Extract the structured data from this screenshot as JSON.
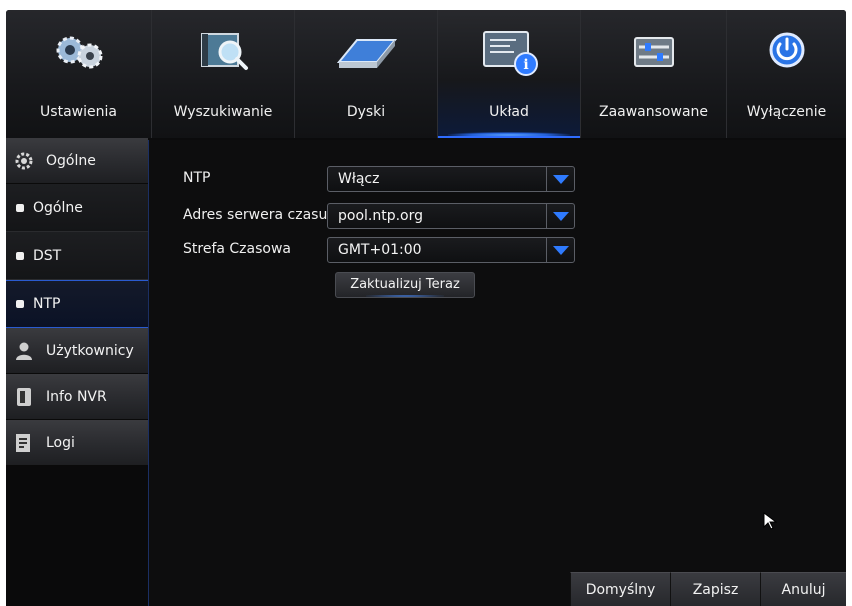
{
  "tabs": [
    {
      "label": "Ustawienia",
      "icon": "gears-icon"
    },
    {
      "label": "Wyszukiwanie",
      "icon": "search-video-icon"
    },
    {
      "label": "Dyski",
      "icon": "hard-disk-icon"
    },
    {
      "label": "Układ",
      "icon": "system-info-icon",
      "active": true
    },
    {
      "label": "Zaawansowane",
      "icon": "sliders-icon"
    },
    {
      "label": "Wyłączenie",
      "icon": "power-icon"
    }
  ],
  "sidebar": {
    "groups": [
      {
        "label": "Ogólne",
        "icon": "gear-icon"
      },
      {
        "label": "Użytkownicy",
        "icon": "user-icon"
      },
      {
        "label": "Info NVR",
        "icon": "info-device-icon"
      },
      {
        "label": "Logi",
        "icon": "log-icon"
      }
    ],
    "sub_items": [
      {
        "label": "Ogólne"
      },
      {
        "label": "DST"
      },
      {
        "label": "NTP",
        "active": true
      }
    ]
  },
  "form": {
    "ntp_label": "NTP",
    "ntp_value": "Włącz",
    "server_label": "Adres serwera czasu",
    "server_value": "pool.ntp.org",
    "timezone_label": "Strefa Czasowa",
    "timezone_value": "GMT+01:00",
    "update_button": "Zaktualizuj Teraz"
  },
  "footer": {
    "default_label": "Domyślny",
    "save_label": "Zapisz",
    "cancel_label": "Anuluj"
  },
  "colors": {
    "accent": "#2f7bff",
    "active_glow": "#5aa2ff",
    "background": "#0b0b0c"
  }
}
